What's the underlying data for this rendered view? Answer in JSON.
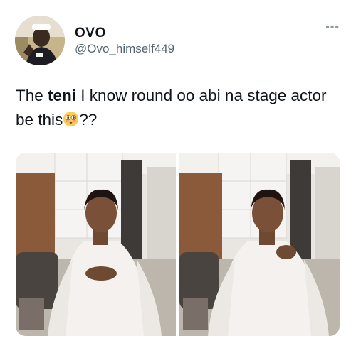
{
  "user": {
    "display_name": "OVO",
    "handle": "@Ovo_himself449",
    "avatar_icon": "profile-photo"
  },
  "more_icon": "•••",
  "tweet": {
    "text_before": "The ",
    "text_bold": "teni",
    "text_after": " I know round oo abi na stage actor be this",
    "emoji": "flushed-face-emoji",
    "text_end": "??"
  },
  "media": {
    "count": 2,
    "photos": [
      "woman-in-white-robe-photo-1",
      "woman-in-white-robe-photo-2"
    ]
  },
  "colors": {
    "text": "#0f1419",
    "secondary": "#536471",
    "robe": "#f4f1ee",
    "wood": "#8a5a3a"
  }
}
